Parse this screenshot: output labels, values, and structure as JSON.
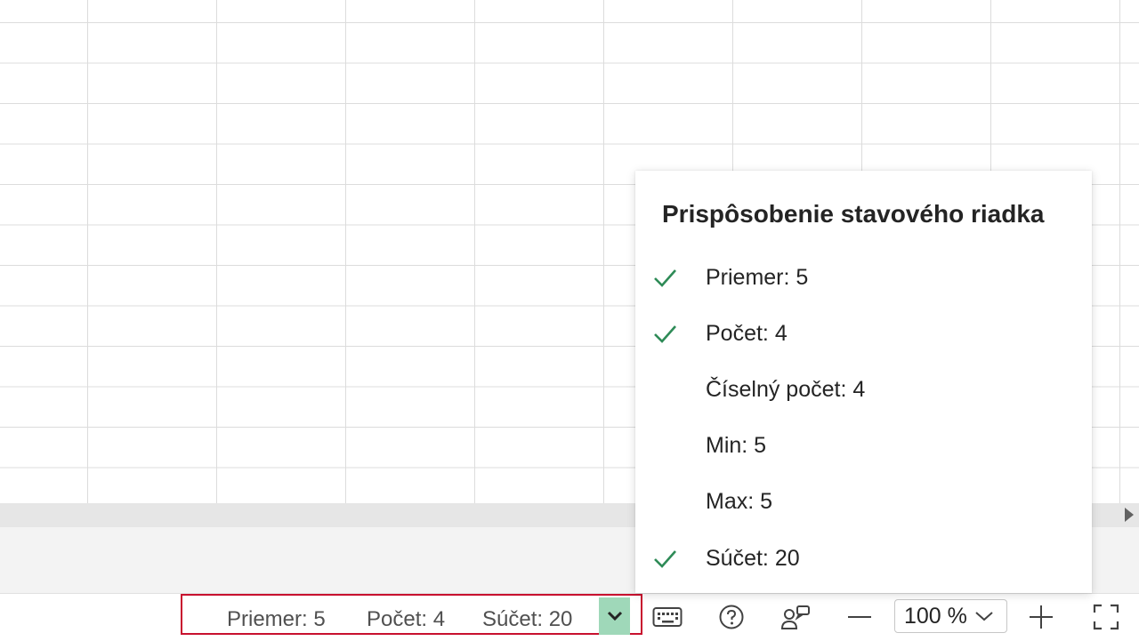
{
  "popup": {
    "title": "Prispôsobenie stavového riadka",
    "items": [
      {
        "label": "Priemer: 5",
        "checked": true
      },
      {
        "label": "Počet: 4",
        "checked": true
      },
      {
        "label": "Číselný počet: 4",
        "checked": false
      },
      {
        "label": "Min: 5",
        "checked": false
      },
      {
        "label": "Max: 5",
        "checked": false
      },
      {
        "label": "Súčet: 20",
        "checked": true
      }
    ]
  },
  "statusbar": {
    "average": "Priemer: 5",
    "count": "Počet: 4",
    "sum": "Súčet: 20",
    "zoom": "100 %",
    "icons": [
      "chevron-down-icon",
      "keyboard-icon",
      "help-icon",
      "feedback-icon",
      "zoom-out-icon",
      "zoom-in-icon",
      "fullscreen-icon"
    ]
  },
  "colors": {
    "check": "#2e8b57",
    "toggle_bg": "#9fd8b9",
    "highlight_frame": "#c8102e"
  }
}
